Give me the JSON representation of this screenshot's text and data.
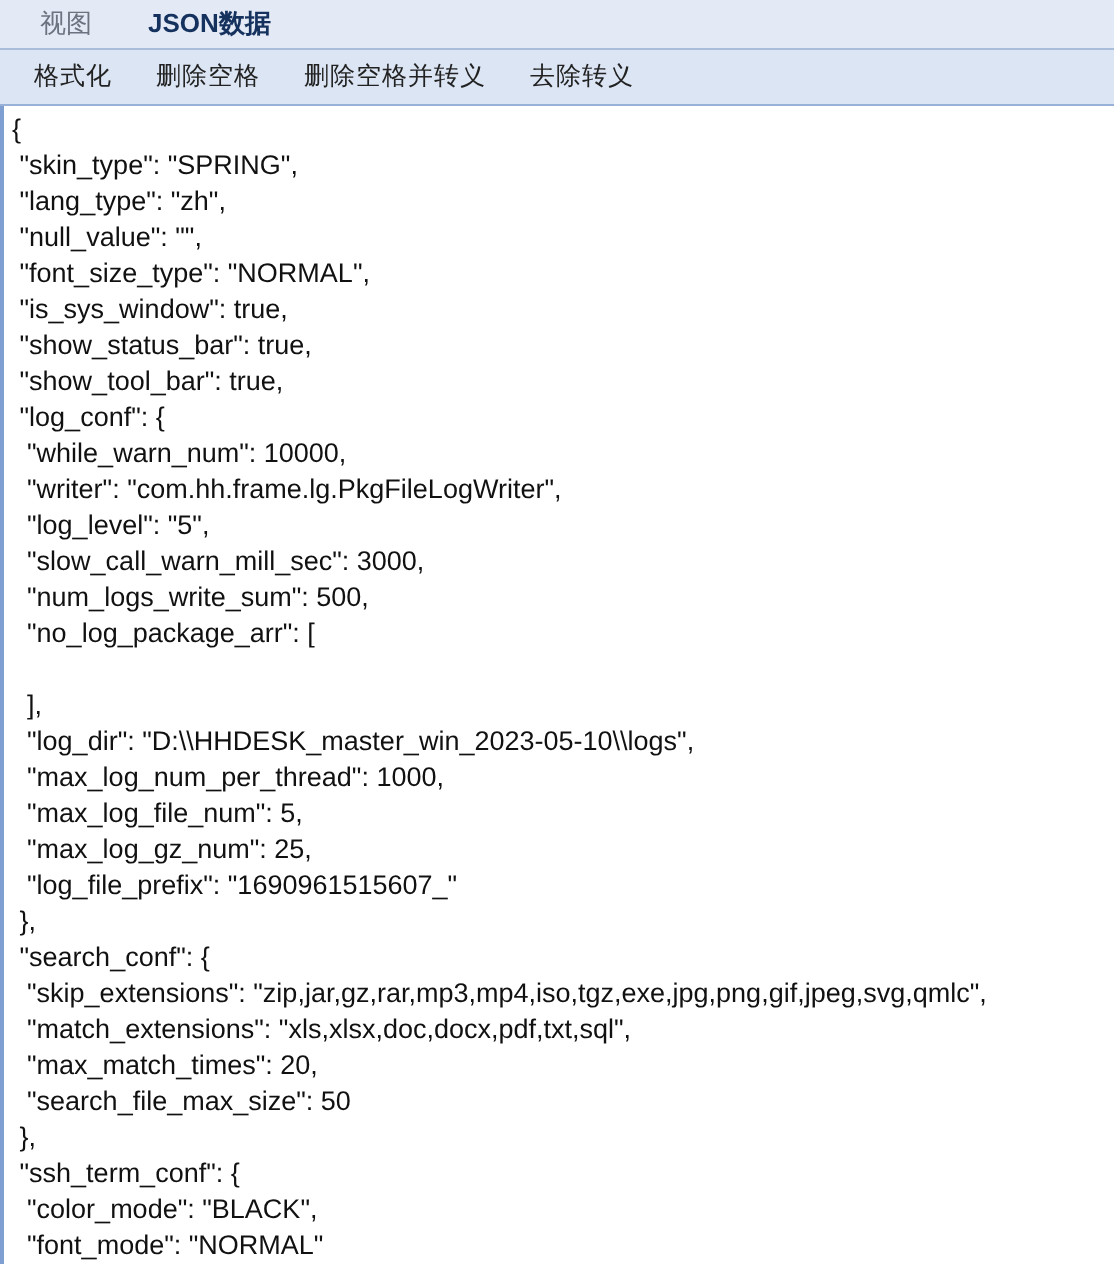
{
  "tabs": [
    {
      "label": "视图",
      "selected": false
    },
    {
      "label": "JSON数据",
      "selected": true
    }
  ],
  "toolbar": {
    "buttons": [
      "格式化",
      "删除空格",
      "删除空格并转义",
      "去除转义"
    ]
  },
  "editor": {
    "text": "{\n \"skin_type\": \"SPRING\",\n \"lang_type\": \"zh\",\n \"null_value\": \"\",\n \"font_size_type\": \"NORMAL\",\n \"is_sys_window\": true,\n \"show_status_bar\": true,\n \"show_tool_bar\": true,\n \"log_conf\": {\n  \"while_warn_num\": 10000,\n  \"writer\": \"com.hh.frame.lg.PkgFileLogWriter\",\n  \"log_level\": \"5\",\n  \"slow_call_warn_mill_sec\": 3000,\n  \"num_logs_write_sum\": 500,\n  \"no_log_package_arr\": [\n\n  ],\n  \"log_dir\": \"D:\\\\HHDESK_master_win_2023-05-10\\\\logs\",\n  \"max_log_num_per_thread\": 1000,\n  \"max_log_file_num\": 5,\n  \"max_log_gz_num\": 25,\n  \"log_file_prefix\": \"1690961515607_\"\n },\n \"search_conf\": {\n  \"skip_extensions\": \"zip,jar,gz,rar,mp3,mp4,iso,tgz,exe,jpg,png,gif,jpeg,svg,qmlc\",\n  \"match_extensions\": \"xls,xlsx,doc,docx,pdf,txt,sql\",\n  \"max_match_times\": 20,\n  \"search_file_max_size\": 50\n },\n \"ssh_term_conf\": {\n  \"color_mode\": \"BLACK\",\n  \"font_mode\": \"NORMAL\""
  }
}
